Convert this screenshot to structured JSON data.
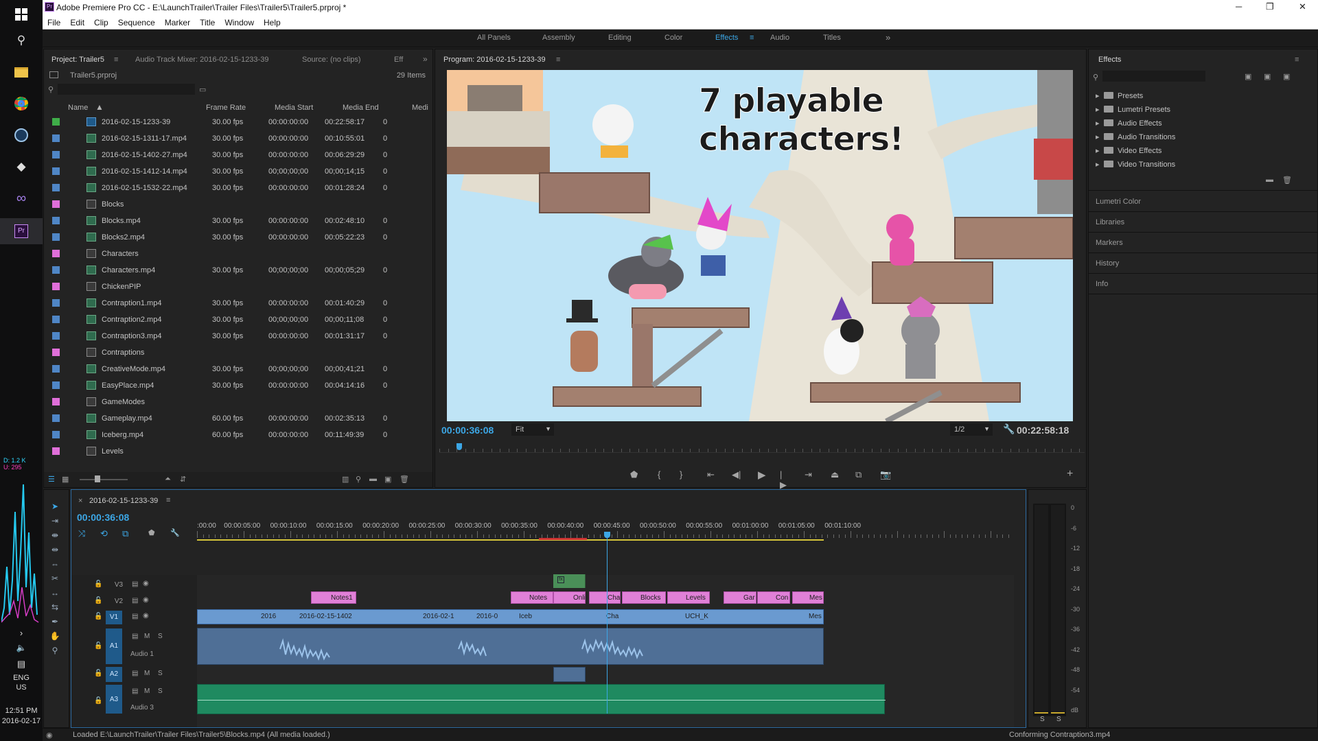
{
  "app": {
    "title": "Adobe Premiere Pro CC - E:\\LaunchTrailer\\Trailer Files\\Trailer5\\Trailer5.prproj *",
    "icon_label": "Pr",
    "menu": [
      "File",
      "Edit",
      "Clip",
      "Sequence",
      "Marker",
      "Title",
      "Window",
      "Help"
    ]
  },
  "taskbar": {
    "net_down": "D: 1.2 K",
    "net_up": "U: 295",
    "lang": "ENG",
    "region": "US",
    "time": "12:51 PM",
    "date": "2016-02-17"
  },
  "workspaces": {
    "items": [
      "All Panels",
      "Assembly",
      "Editing",
      "Color",
      "Effects",
      "Audio",
      "Titles"
    ],
    "active": "Effects",
    "more": "»"
  },
  "project": {
    "tabs": [
      "Project: Trailer5",
      "Audio Track Mixer: 2016-02-15-1233-39",
      "Source: (no clips)",
      "Eff"
    ],
    "file": "Trailer5.prproj",
    "count": "29 Items",
    "headers": [
      "Name",
      "Frame Rate",
      "Media Start",
      "Media End",
      "Medi"
    ],
    "rows": [
      {
        "name": "2016-02-15-1233-39",
        "rate": "30.00 fps",
        "start": "00:00:00:00",
        "end": "00:22:58:17",
        "extra": "0",
        "kind": "seq",
        "color": "#3fae49"
      },
      {
        "name": "2016-02-15-1311-17.mp4",
        "rate": "30.00 fps",
        "start": "00:00:00:00",
        "end": "00:10:55:01",
        "extra": "0",
        "kind": "vid",
        "color": "#4f86c6"
      },
      {
        "name": "2016-02-15-1402-27.mp4",
        "rate": "30.00 fps",
        "start": "00:00:00:00",
        "end": "00:06:29:29",
        "extra": "0",
        "kind": "vid",
        "color": "#4f86c6"
      },
      {
        "name": "2016-02-15-1412-14.mp4",
        "rate": "30.00 fps",
        "start": "00;00;00;00",
        "end": "00;00;14;15",
        "extra": "0",
        "kind": "vid",
        "color": "#4f86c6"
      },
      {
        "name": "2016-02-15-1532-22.mp4",
        "rate": "30.00 fps",
        "start": "00:00:00:00",
        "end": "00:01:28:24",
        "extra": "0",
        "kind": "vid",
        "color": "#4f86c6"
      },
      {
        "name": "Blocks",
        "rate": "",
        "start": "",
        "end": "",
        "extra": "",
        "kind": "img",
        "color": "#e06fd9"
      },
      {
        "name": "Blocks.mp4",
        "rate": "30.00 fps",
        "start": "00:00:00:00",
        "end": "00:02:48:10",
        "extra": "0",
        "kind": "vid",
        "color": "#4f86c6"
      },
      {
        "name": "Blocks2.mp4",
        "rate": "30.00 fps",
        "start": "00:00:00:00",
        "end": "00:05:22:23",
        "extra": "0",
        "kind": "vid",
        "color": "#4f86c6"
      },
      {
        "name": "Characters",
        "rate": "",
        "start": "",
        "end": "",
        "extra": "",
        "kind": "img",
        "color": "#e06fd9"
      },
      {
        "name": "Characters.mp4",
        "rate": "30.00 fps",
        "start": "00;00;00;00",
        "end": "00;00;05;29",
        "extra": "0",
        "kind": "vid",
        "color": "#4f86c6"
      },
      {
        "name": "ChickenPIP",
        "rate": "",
        "start": "",
        "end": "",
        "extra": "",
        "kind": "img",
        "color": "#e06fd9"
      },
      {
        "name": "Contraption1.mp4",
        "rate": "30.00 fps",
        "start": "00:00:00:00",
        "end": "00:01:40:29",
        "extra": "0",
        "kind": "vid",
        "color": "#4f86c6"
      },
      {
        "name": "Contraption2.mp4",
        "rate": "30.00 fps",
        "start": "00;00;00;00",
        "end": "00;00;11;08",
        "extra": "0",
        "kind": "vid",
        "color": "#4f86c6"
      },
      {
        "name": "Contraption3.mp4",
        "rate": "30.00 fps",
        "start": "00:00:00:00",
        "end": "00:01:31:17",
        "extra": "0",
        "kind": "vid",
        "color": "#4f86c6"
      },
      {
        "name": "Contraptions",
        "rate": "",
        "start": "",
        "end": "",
        "extra": "",
        "kind": "img",
        "color": "#e06fd9"
      },
      {
        "name": "CreativeMode.mp4",
        "rate": "30.00 fps",
        "start": "00;00;00;00",
        "end": "00;00;41;21",
        "extra": "0",
        "kind": "vid",
        "color": "#4f86c6"
      },
      {
        "name": "EasyPlace.mp4",
        "rate": "30.00 fps",
        "start": "00:00:00:00",
        "end": "00:04:14:16",
        "extra": "0",
        "kind": "vid",
        "color": "#4f86c6"
      },
      {
        "name": "GameModes",
        "rate": "",
        "start": "",
        "end": "",
        "extra": "",
        "kind": "img",
        "color": "#e06fd9"
      },
      {
        "name": "Gameplay.mp4",
        "rate": "60.00 fps",
        "start": "00:00:00:00",
        "end": "00:02:35:13",
        "extra": "0",
        "kind": "vid",
        "color": "#4f86c6"
      },
      {
        "name": "Iceberg.mp4",
        "rate": "60.00 fps",
        "start": "00:00:00:00",
        "end": "00:11:49:39",
        "extra": "0",
        "kind": "vid",
        "color": "#4f86c6"
      },
      {
        "name": "Levels",
        "rate": "",
        "start": "",
        "end": "",
        "extra": "",
        "kind": "img",
        "color": "#e06fd9"
      }
    ]
  },
  "program": {
    "tab": "Program: 2016-02-15-1233-39",
    "overlay_text": "7 playable characters!",
    "timecode": "00:00:36:08",
    "fit": "Fit",
    "resolution": "1/2",
    "duration": "00:22:58:18",
    "playhead_fraction": 0.0265
  },
  "effects": {
    "title": "Effects",
    "tree": [
      "Presets",
      "Lumetri Presets",
      "Audio Effects",
      "Audio Transitions",
      "Video Effects",
      "Video Transitions"
    ],
    "side_panels": [
      "Lumetri Color",
      "Libraries",
      "Markers",
      "History",
      "Info"
    ]
  },
  "timeline": {
    "sequence": "2016-02-15-1233-39",
    "timecode": "00:00:36:08",
    "ruler": [
      ":00:00",
      "00:00:05:00",
      "00:00:10:00",
      "00:00:15:00",
      "00:00:20:00",
      "00:00:25:00",
      "00:00:30:00",
      "00:00:35:00",
      "00:00:40:00",
      "00:00:45:00",
      "00:00:50:00",
      "00:00:55:00",
      "00:01:00:00",
      "00:01:05:00",
      "00:01:10:00"
    ],
    "tracks": {
      "v3": "V3",
      "v2": "V2",
      "v1": "V1",
      "a1": "A1",
      "a2": "A2",
      "a3": "A3",
      "a1_name": "Audio 1",
      "a3_name": "Audio 3",
      "m": "M",
      "s": "S"
    },
    "v2_clips": [
      "Notes1",
      "Notes",
      "Onli",
      "Cha",
      "Blocks",
      "Levels",
      "Gar",
      "Con",
      "Mes"
    ],
    "v1_clips": [
      "2016",
      "2016-02-15-1402",
      "2016-02-1",
      "2016-0",
      "Iceb",
      "Cha",
      "UCH_K",
      "Mes"
    ],
    "fx_badge": "fx"
  },
  "meter": {
    "scale": [
      "0",
      "-6",
      "-12",
      "-18",
      "-24",
      "-30",
      "-36",
      "-42",
      "-48",
      "-54",
      "dB"
    ],
    "solo": [
      "S",
      "S"
    ]
  },
  "status": {
    "left": "Loaded E:\\LaunchTrailer\\Trailer Files\\Trailer5\\Blocks.mp4 (All media loaded.)",
    "right": "Conforming Contraption3.mp4"
  }
}
